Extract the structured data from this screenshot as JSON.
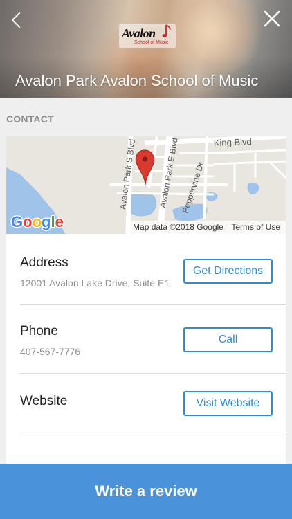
{
  "header": {
    "title": "Avalon Park Avalon School of Music",
    "logo": {
      "brand": "Avalon",
      "subtitle": "School of Music"
    },
    "back_icon": "chevron-left-icon",
    "close_icon": "close-icon"
  },
  "contact": {
    "section_label": "CONTACT",
    "map": {
      "labels": [
        "King Blvd",
        "Avalon Park S Blvd",
        "Avalon Park E Blvd",
        "Peppervine Dr"
      ],
      "google_logo": "Google",
      "map_data": "Map data ©2018 Google",
      "terms": "Terms of Use"
    },
    "address": {
      "label": "Address",
      "value": "12001 Avalon Lake Drive, Suite E1",
      "button": "Get Directions"
    },
    "phone": {
      "label": "Phone",
      "value": "407-567-7776",
      "button": "Call"
    },
    "website": {
      "label": "Website",
      "button": "Visit Website"
    }
  },
  "footer": {
    "review_button": "Write a review"
  },
  "colors": {
    "accent": "#2d8ad6",
    "review_bar": "#4a92d9",
    "map_pin": "#d93a2f",
    "water": "#9fc3e9"
  }
}
